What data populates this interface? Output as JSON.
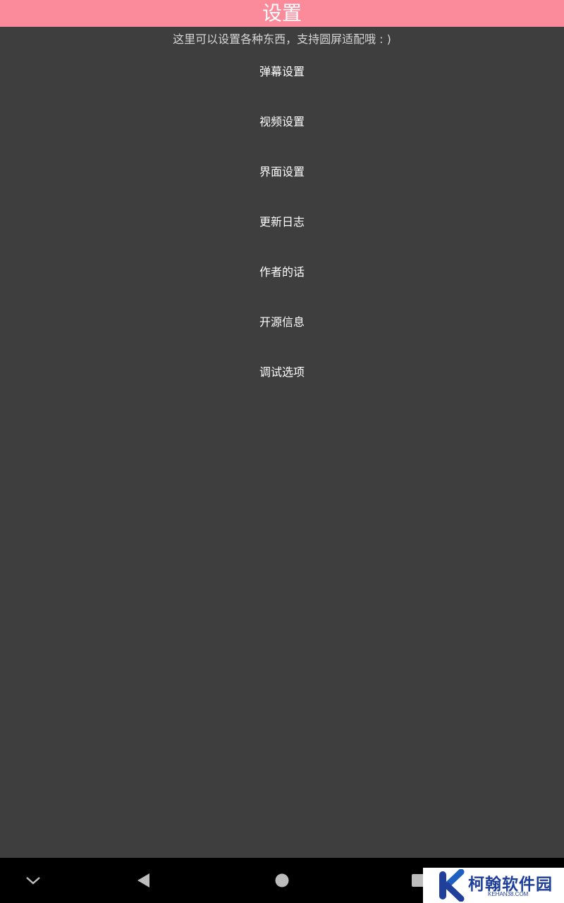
{
  "header": {
    "title": "设置",
    "background": "#fb8b9a"
  },
  "subtitle": "这里可以设置各种东西，支持圆屏适配哦 : )",
  "menu": {
    "items": [
      {
        "label": "弹幕设置"
      },
      {
        "label": "视频设置"
      },
      {
        "label": "界面设置"
      },
      {
        "label": "更新日志"
      },
      {
        "label": "作者的话"
      },
      {
        "label": "开源信息"
      },
      {
        "label": "调试选项"
      }
    ]
  },
  "navbar": {
    "buttons": [
      "chevron-down-icon",
      "back-icon",
      "home-icon",
      "recents-icon"
    ]
  },
  "watermark": {
    "name": "柯翰软件园",
    "domain": "KEHAN38.COM",
    "accent": "#1f3f9a"
  }
}
